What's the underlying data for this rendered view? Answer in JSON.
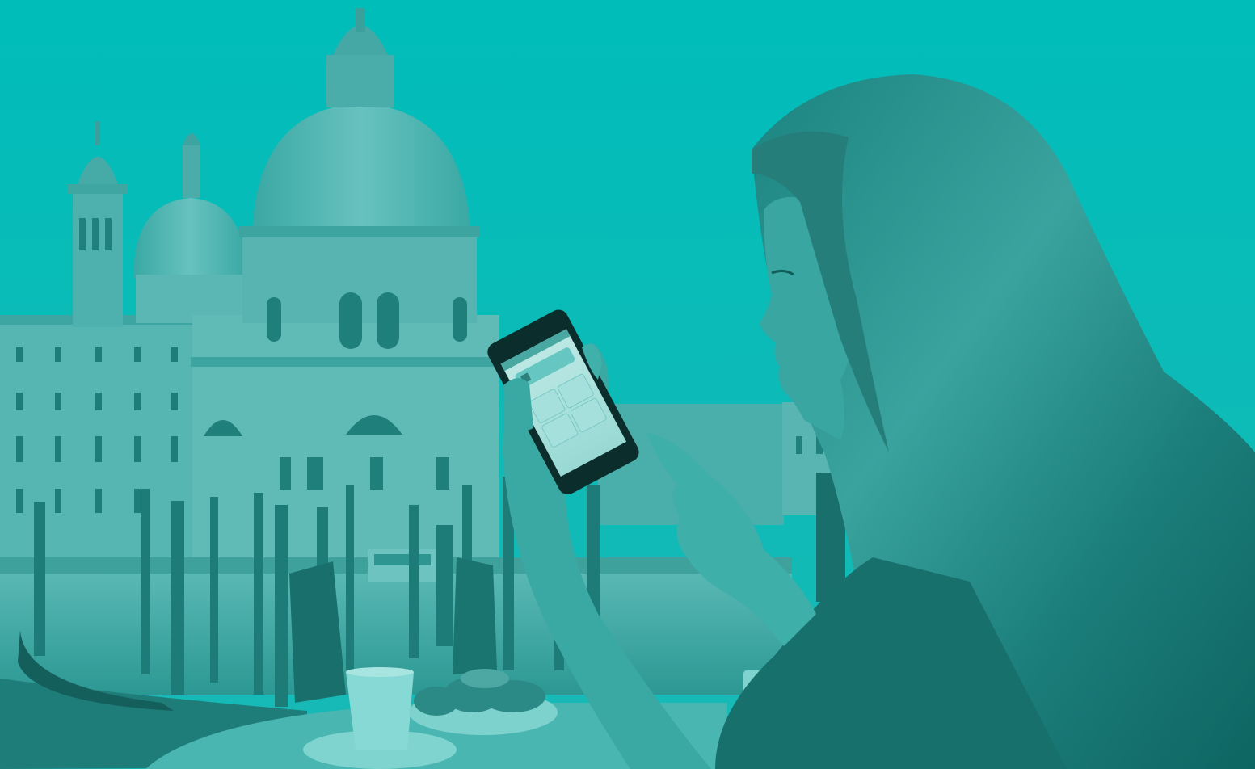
{
  "scene": {
    "subject": "woman-with-smartphone",
    "setting": "venice-canal-cafe",
    "tint_color": "#00BDBA",
    "tint_dark": "#0a6f6c",
    "tint_mid": "#2aa7a3",
    "tint_light": "#7fd8d4"
  },
  "phone_screen": {
    "icons": [
      "lock-icon",
      "grid-buttons"
    ],
    "header_button": "",
    "grid": [
      "",
      "",
      "",
      ""
    ]
  }
}
